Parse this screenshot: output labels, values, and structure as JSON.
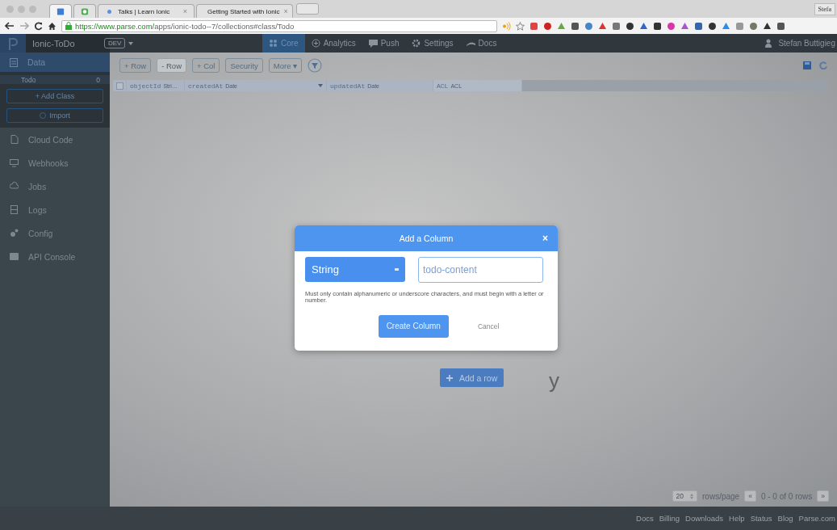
{
  "browser": {
    "tabs": [
      {
        "selected": true
      },
      {
        "selected": false
      },
      {
        "title": "Talks | Learn Ionic",
        "selected": false
      },
      {
        "title": "Getting Started with Ionic",
        "selected": false
      }
    ],
    "tab_close": "×",
    "profile": "Stefa",
    "url_host": "https://www.parse.com/",
    "url_path": "apps/ionic-todo--7/collections#class/Todo"
  },
  "header": {
    "app_name": "Ionic-ToDo",
    "environment": "DEV",
    "nav": [
      {
        "label": "Core",
        "selected": true
      },
      {
        "label": "Analytics",
        "selected": false
      },
      {
        "label": "Push",
        "selected": false
      },
      {
        "label": "Settings",
        "selected": false
      },
      {
        "label": "Docs",
        "selected": false
      }
    ],
    "user": "Stefan Buttigieg"
  },
  "sidebar": {
    "section": {
      "label": "Data",
      "selected": true
    },
    "classes": [
      {
        "name": "Todo",
        "count": "0"
      }
    ],
    "add_class": "+ Add Class",
    "import": "Import",
    "items": [
      {
        "label": "Cloud Code"
      },
      {
        "label": "Webhooks"
      },
      {
        "label": "Jobs"
      },
      {
        "label": "Logs"
      },
      {
        "label": "Config"
      },
      {
        "label": "API Console"
      }
    ]
  },
  "toolbar": [
    {
      "label": "+ Row",
      "disabled": false
    },
    {
      "label": "- Row",
      "disabled": true
    },
    {
      "label": "+ Col",
      "disabled": false
    },
    {
      "label": "Security",
      "disabled": false
    },
    {
      "label": "More ▾",
      "disabled": false
    }
  ],
  "table": {
    "select_all_checked": false,
    "columns": [
      {
        "name": "objectId",
        "type": "Stri…"
      },
      {
        "name": "createdAt",
        "type": "Date"
      },
      {
        "name": "updatedAt",
        "type": "Date"
      },
      {
        "name": "ACL",
        "type": "ACL"
      }
    ]
  },
  "empty_state": {
    "visible_text": "y",
    "button": "Add a row"
  },
  "pagination": {
    "page_size": "20",
    "label": "rows/page",
    "prev": "«",
    "range": "0 - 0 of 0 rows",
    "next": "»"
  },
  "footer": [
    "Docs",
    "Billing",
    "Downloads",
    "Help",
    "Status",
    "Blog",
    "Parse.com"
  ],
  "dialog": {
    "title": "Add a Column",
    "close": "×",
    "type": "String",
    "name_value": "todo-content",
    "hint": "Must only contain alphanumeric or underscore characters, and must begin with a letter or number.",
    "primary": "Create Column",
    "secondary": "Cancel"
  }
}
